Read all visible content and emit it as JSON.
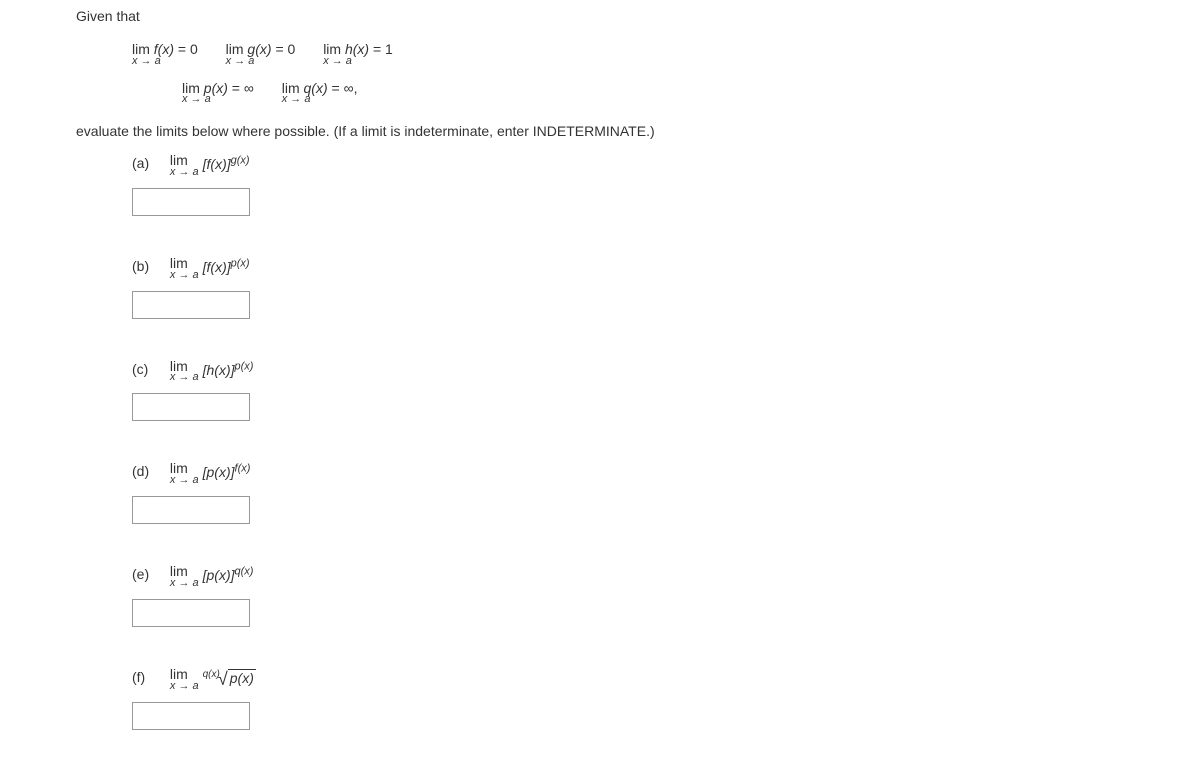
{
  "intro": "Given that",
  "given": {
    "f": {
      "lhs": "f(x)",
      "rhs": "= 0"
    },
    "g": {
      "lhs": "g(x)",
      "rhs": "= 0"
    },
    "h": {
      "lhs": "h(x)",
      "rhs": "= 1"
    },
    "p": {
      "lhs": "p(x)",
      "rhs": "= ∞"
    },
    "q": {
      "lhs": "q(x)",
      "rhs": "= ∞,"
    },
    "lim_label": "lim",
    "lim_sub": "x → a"
  },
  "eval_text": "evaluate the limits below where possible. (If a limit is indeterminate, enter INDETERMINATE.)",
  "parts": {
    "a": {
      "label": "(a)",
      "base": "[f(x)]",
      "exp": "g(x)"
    },
    "b": {
      "label": "(b)",
      "base": "[f(x)]",
      "exp": "p(x)"
    },
    "c": {
      "label": "(c)",
      "base": "[h(x)]",
      "exp": "p(x)"
    },
    "d": {
      "label": "(d)",
      "base": "[p(x)]",
      "exp": "f(x)"
    },
    "e": {
      "label": "(e)",
      "base": "[p(x)]",
      "exp": "q(x)"
    },
    "f": {
      "label": "(f)",
      "root_index": "q(x)",
      "radicand": "p(x)"
    }
  }
}
